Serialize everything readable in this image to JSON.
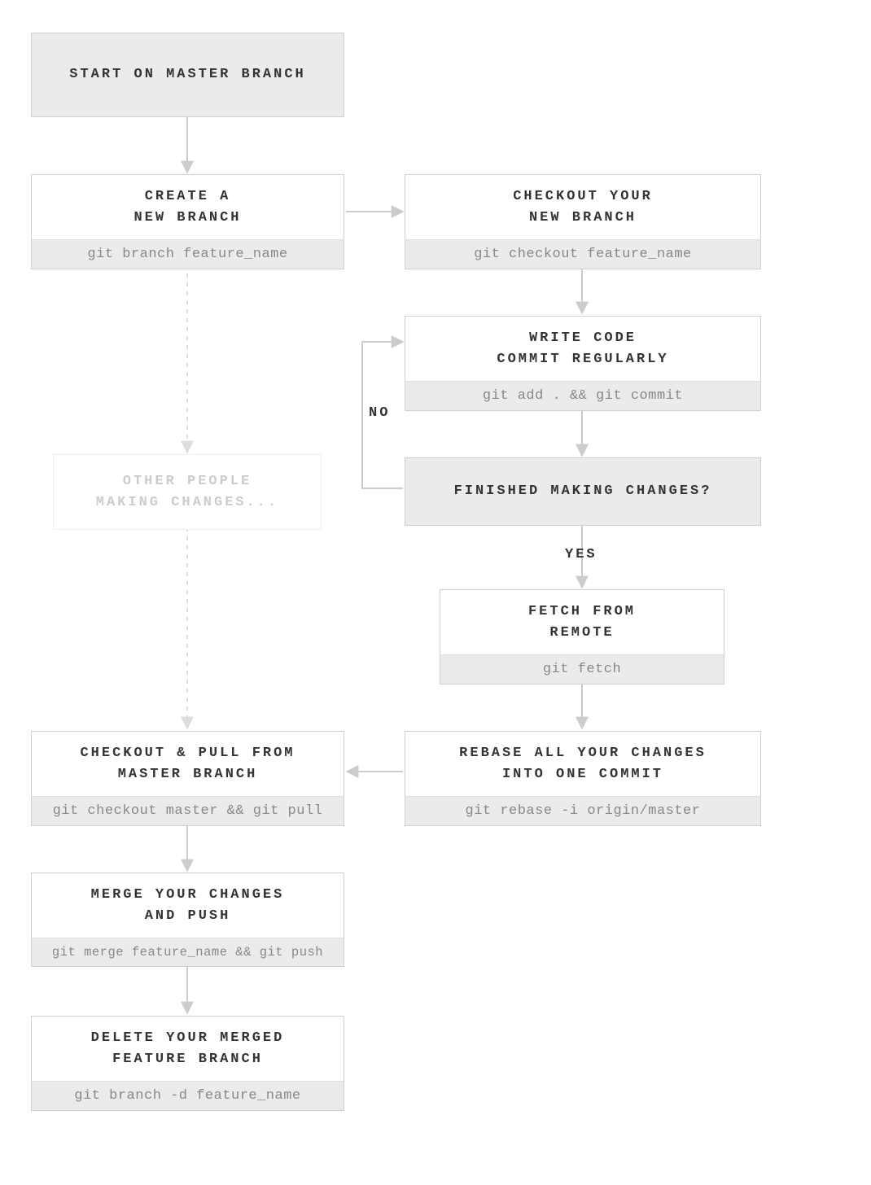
{
  "nodes": {
    "start": {
      "title": "START ON MASTER BRANCH"
    },
    "create": {
      "title": "CREATE A\nNEW BRANCH",
      "cmd": "git branch feature_name"
    },
    "checkout": {
      "title": "CHECKOUT YOUR\nNEW BRANCH",
      "cmd": "git checkout feature_name"
    },
    "write": {
      "title": "WRITE CODE\nCOMMIT REGULARLY",
      "cmd": "git add . && git commit"
    },
    "finished": {
      "title": "FINISHED MAKING CHANGES?"
    },
    "others": {
      "title": "OTHER PEOPLE\nMAKING CHANGES..."
    },
    "fetch": {
      "title": "FETCH FROM\nREMOTE",
      "cmd": "git fetch"
    },
    "rebase": {
      "title": "REBASE ALL YOUR CHANGES\nINTO ONE COMMIT",
      "cmd": "git rebase -i origin/master"
    },
    "pull": {
      "title": "CHECKOUT & PULL FROM\nMASTER BRANCH",
      "cmd": "git checkout master && git pull"
    },
    "merge": {
      "title": "MERGE YOUR CHANGES\nAND PUSH",
      "cmd": "git merge feature_name && git push"
    },
    "delete": {
      "title": "DELETE YOUR MERGED\nFEATURE BRANCH",
      "cmd": "git branch -d feature_name"
    }
  },
  "labels": {
    "no": "NO",
    "yes": "YES"
  },
  "chart_data": {
    "type": "flowchart",
    "nodes": [
      {
        "id": "start",
        "label": "START ON MASTER BRANCH",
        "kind": "terminal"
      },
      {
        "id": "create",
        "label": "CREATE A NEW BRANCH",
        "command": "git branch feature_name",
        "kind": "process"
      },
      {
        "id": "checkout",
        "label": "CHECKOUT YOUR NEW BRANCH",
        "command": "git checkout feature_name",
        "kind": "process"
      },
      {
        "id": "write",
        "label": "WRITE CODE COMMIT REGULARLY",
        "command": "git add . && git commit",
        "kind": "process"
      },
      {
        "id": "finished",
        "label": "FINISHED MAKING CHANGES?",
        "kind": "decision"
      },
      {
        "id": "others",
        "label": "OTHER PEOPLE MAKING CHANGES...",
        "kind": "annotation"
      },
      {
        "id": "fetch",
        "label": "FETCH FROM REMOTE",
        "command": "git fetch",
        "kind": "process"
      },
      {
        "id": "rebase",
        "label": "REBASE ALL YOUR CHANGES INTO ONE COMMIT",
        "command": "git rebase -i origin/master",
        "kind": "process"
      },
      {
        "id": "pull",
        "label": "CHECKOUT & PULL FROM MASTER BRANCH",
        "command": "git checkout master && git pull",
        "kind": "process"
      },
      {
        "id": "merge",
        "label": "MERGE YOUR CHANGES AND PUSH",
        "command": "git merge feature_name && git push",
        "kind": "process"
      },
      {
        "id": "delete",
        "label": "DELETE YOUR MERGED FEATURE BRANCH",
        "command": "git branch -d feature_name",
        "kind": "process"
      }
    ],
    "edges": [
      {
        "from": "start",
        "to": "create"
      },
      {
        "from": "create",
        "to": "checkout"
      },
      {
        "from": "checkout",
        "to": "write"
      },
      {
        "from": "write",
        "to": "finished"
      },
      {
        "from": "finished",
        "to": "write",
        "label": "NO"
      },
      {
        "from": "finished",
        "to": "fetch",
        "label": "YES"
      },
      {
        "from": "fetch",
        "to": "rebase"
      },
      {
        "from": "rebase",
        "to": "pull"
      },
      {
        "from": "create",
        "to": "others",
        "style": "dashed"
      },
      {
        "from": "others",
        "to": "pull",
        "style": "dashed"
      },
      {
        "from": "pull",
        "to": "merge"
      },
      {
        "from": "merge",
        "to": "delete"
      }
    ]
  }
}
